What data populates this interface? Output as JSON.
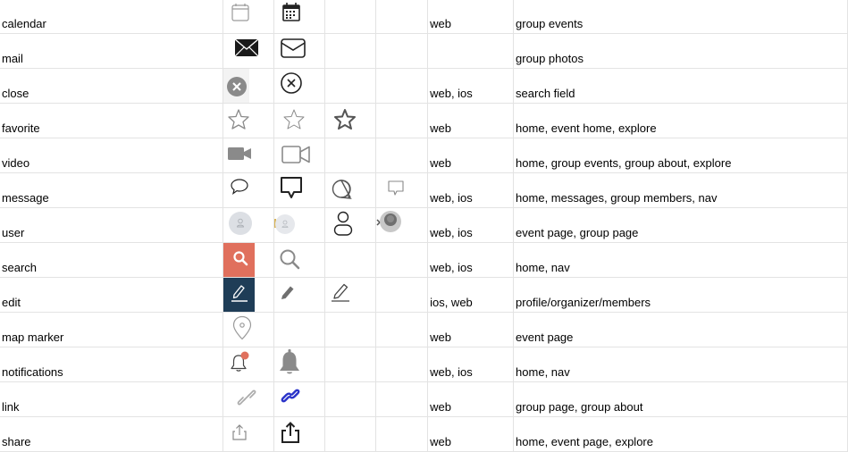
{
  "rows": [
    {
      "name": "calendar",
      "platforms": "web",
      "usage": "group events"
    },
    {
      "name": "mail",
      "platforms": "",
      "usage": "group photos"
    },
    {
      "name": "close",
      "platforms": "web, ios",
      "usage": "search field"
    },
    {
      "name": "favorite",
      "platforms": "web",
      "usage": "home, event home, explore"
    },
    {
      "name": "video",
      "platforms": "web",
      "usage": "home, group events, group about, explore"
    },
    {
      "name": "message",
      "platforms": "web, ios",
      "usage": "home, messages, group members, nav"
    },
    {
      "name": "user",
      "platforms": "web, ios",
      "usage": "event page, group page"
    },
    {
      "name": "search",
      "platforms": "web, ios",
      "usage": "home, nav"
    },
    {
      "name": "edit",
      "platforms": "ios, web",
      "usage": "profile/organizer/members"
    },
    {
      "name": "map marker",
      "platforms": "web",
      "usage": "event page"
    },
    {
      "name": "notifications",
      "platforms": "web, ios",
      "usage": "home, nav"
    },
    {
      "name": "link",
      "platforms": "web",
      "usage": "group page, group about"
    },
    {
      "name": "share",
      "platforms": "web",
      "usage": "home, event page, explore"
    }
  ],
  "icons": {
    "calendar": [
      "calendar-outline-icon",
      "calendar-filled-icon"
    ],
    "mail": [
      "envelope-filled-icon",
      "envelope-outline-icon"
    ],
    "close": [
      "close-circle-filled-icon",
      "close-circle-outline-icon"
    ],
    "favorite": [
      "star-outline-light-icon",
      "star-outline-thin-icon",
      "star-outline-bold-icon"
    ],
    "video": [
      "video-camera-filled-icon",
      "video-camera-outline-icon"
    ],
    "message": [
      "speech-bubble-small-icon",
      "speech-bubble-bold-icon",
      "speech-bubble-round-icon",
      "speech-bubble-light-icon"
    ],
    "user": [
      "avatar-placeholder-icon",
      "avatar-placeholder-small-icon",
      "user-outline-icon",
      "avatar-photo-icon"
    ],
    "search": [
      "search-button-icon",
      "magnifier-icon"
    ],
    "edit": [
      "edit-button-icon",
      "pencil-filled-icon",
      "pencil-outline-icon"
    ],
    "map marker": [
      "map-marker-icon"
    ],
    "notifications": [
      "bell-with-badge-icon",
      "bell-filled-icon"
    ],
    "link": [
      "link-gray-icon",
      "link-blue-icon"
    ],
    "share": [
      "share-light-icon",
      "share-bold-icon"
    ]
  },
  "colors": {
    "search_button_bg": "#e0705d",
    "edit_button_bg": "#1f3d57",
    "notification_dot": "#e0705d",
    "link_blue": "#2a33c9",
    "border": "#e3e3e3"
  }
}
